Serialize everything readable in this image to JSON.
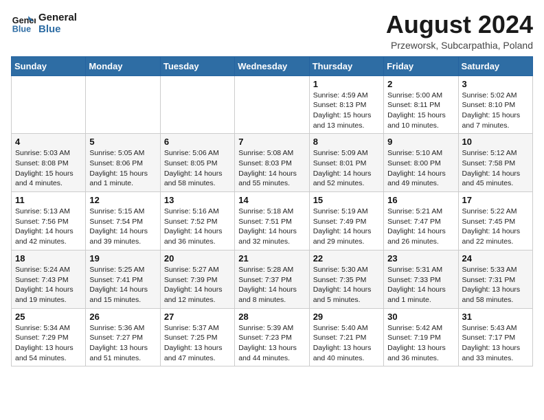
{
  "header": {
    "logo_line1": "General",
    "logo_line2": "Blue",
    "month_year": "August 2024",
    "location": "Przeworsk, Subcarpathia, Poland"
  },
  "weekdays": [
    "Sunday",
    "Monday",
    "Tuesday",
    "Wednesday",
    "Thursday",
    "Friday",
    "Saturday"
  ],
  "weeks": [
    [
      {
        "day": "",
        "info": ""
      },
      {
        "day": "",
        "info": ""
      },
      {
        "day": "",
        "info": ""
      },
      {
        "day": "",
        "info": ""
      },
      {
        "day": "1",
        "info": "Sunrise: 4:59 AM\nSunset: 8:13 PM\nDaylight: 15 hours\nand 13 minutes."
      },
      {
        "day": "2",
        "info": "Sunrise: 5:00 AM\nSunset: 8:11 PM\nDaylight: 15 hours\nand 10 minutes."
      },
      {
        "day": "3",
        "info": "Sunrise: 5:02 AM\nSunset: 8:10 PM\nDaylight: 15 hours\nand 7 minutes."
      }
    ],
    [
      {
        "day": "4",
        "info": "Sunrise: 5:03 AM\nSunset: 8:08 PM\nDaylight: 15 hours\nand 4 minutes."
      },
      {
        "day": "5",
        "info": "Sunrise: 5:05 AM\nSunset: 8:06 PM\nDaylight: 15 hours\nand 1 minute."
      },
      {
        "day": "6",
        "info": "Sunrise: 5:06 AM\nSunset: 8:05 PM\nDaylight: 14 hours\nand 58 minutes."
      },
      {
        "day": "7",
        "info": "Sunrise: 5:08 AM\nSunset: 8:03 PM\nDaylight: 14 hours\nand 55 minutes."
      },
      {
        "day": "8",
        "info": "Sunrise: 5:09 AM\nSunset: 8:01 PM\nDaylight: 14 hours\nand 52 minutes."
      },
      {
        "day": "9",
        "info": "Sunrise: 5:10 AM\nSunset: 8:00 PM\nDaylight: 14 hours\nand 49 minutes."
      },
      {
        "day": "10",
        "info": "Sunrise: 5:12 AM\nSunset: 7:58 PM\nDaylight: 14 hours\nand 45 minutes."
      }
    ],
    [
      {
        "day": "11",
        "info": "Sunrise: 5:13 AM\nSunset: 7:56 PM\nDaylight: 14 hours\nand 42 minutes."
      },
      {
        "day": "12",
        "info": "Sunrise: 5:15 AM\nSunset: 7:54 PM\nDaylight: 14 hours\nand 39 minutes."
      },
      {
        "day": "13",
        "info": "Sunrise: 5:16 AM\nSunset: 7:52 PM\nDaylight: 14 hours\nand 36 minutes."
      },
      {
        "day": "14",
        "info": "Sunrise: 5:18 AM\nSunset: 7:51 PM\nDaylight: 14 hours\nand 32 minutes."
      },
      {
        "day": "15",
        "info": "Sunrise: 5:19 AM\nSunset: 7:49 PM\nDaylight: 14 hours\nand 29 minutes."
      },
      {
        "day": "16",
        "info": "Sunrise: 5:21 AM\nSunset: 7:47 PM\nDaylight: 14 hours\nand 26 minutes."
      },
      {
        "day": "17",
        "info": "Sunrise: 5:22 AM\nSunset: 7:45 PM\nDaylight: 14 hours\nand 22 minutes."
      }
    ],
    [
      {
        "day": "18",
        "info": "Sunrise: 5:24 AM\nSunset: 7:43 PM\nDaylight: 14 hours\nand 19 minutes."
      },
      {
        "day": "19",
        "info": "Sunrise: 5:25 AM\nSunset: 7:41 PM\nDaylight: 14 hours\nand 15 minutes."
      },
      {
        "day": "20",
        "info": "Sunrise: 5:27 AM\nSunset: 7:39 PM\nDaylight: 14 hours\nand 12 minutes."
      },
      {
        "day": "21",
        "info": "Sunrise: 5:28 AM\nSunset: 7:37 PM\nDaylight: 14 hours\nand 8 minutes."
      },
      {
        "day": "22",
        "info": "Sunrise: 5:30 AM\nSunset: 7:35 PM\nDaylight: 14 hours\nand 5 minutes."
      },
      {
        "day": "23",
        "info": "Sunrise: 5:31 AM\nSunset: 7:33 PM\nDaylight: 14 hours\nand 1 minute."
      },
      {
        "day": "24",
        "info": "Sunrise: 5:33 AM\nSunset: 7:31 PM\nDaylight: 13 hours\nand 58 minutes."
      }
    ],
    [
      {
        "day": "25",
        "info": "Sunrise: 5:34 AM\nSunset: 7:29 PM\nDaylight: 13 hours\nand 54 minutes."
      },
      {
        "day": "26",
        "info": "Sunrise: 5:36 AM\nSunset: 7:27 PM\nDaylight: 13 hours\nand 51 minutes."
      },
      {
        "day": "27",
        "info": "Sunrise: 5:37 AM\nSunset: 7:25 PM\nDaylight: 13 hours\nand 47 minutes."
      },
      {
        "day": "28",
        "info": "Sunrise: 5:39 AM\nSunset: 7:23 PM\nDaylight: 13 hours\nand 44 minutes."
      },
      {
        "day": "29",
        "info": "Sunrise: 5:40 AM\nSunset: 7:21 PM\nDaylight: 13 hours\nand 40 minutes."
      },
      {
        "day": "30",
        "info": "Sunrise: 5:42 AM\nSunset: 7:19 PM\nDaylight: 13 hours\nand 36 minutes."
      },
      {
        "day": "31",
        "info": "Sunrise: 5:43 AM\nSunset: 7:17 PM\nDaylight: 13 hours\nand 33 minutes."
      }
    ]
  ]
}
